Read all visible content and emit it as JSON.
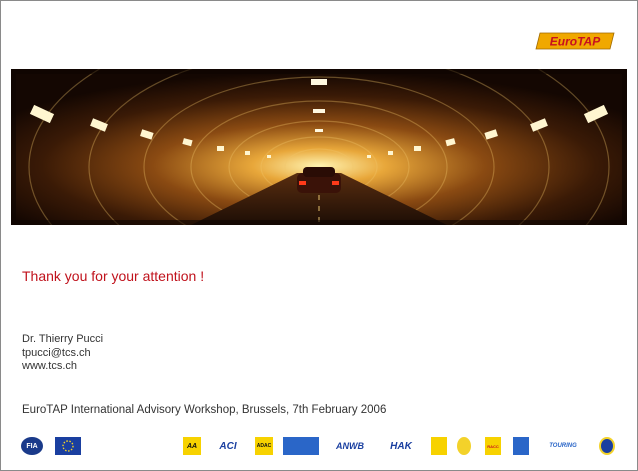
{
  "brand_logo": {
    "text": "EuroTAP",
    "color": "#f0a800",
    "text_color": "#c8101e"
  },
  "hero": {
    "icon": "road-tunnel-photo",
    "description_hidden": true
  },
  "thanks": {
    "text": "Thank you for your attention !",
    "color": "#c0121c"
  },
  "contact": {
    "name": "Dr. Thierry Pucci",
    "email": "tpucci@tcs.ch",
    "website": "www.tcs.ch"
  },
  "event": {
    "text": "EuroTAP International Advisory Workshop, Brussels, 7th February 2006"
  },
  "footer_logos": [
    {
      "icon": "fia-logo",
      "text": "FIA"
    },
    {
      "icon": "eu-flag-logo",
      "text": ""
    },
    {
      "icon": "aa-logo",
      "text": "AA"
    },
    {
      "icon": "aci-logo",
      "text": "ACI"
    },
    {
      "icon": "adac-logo",
      "text": "ADAC"
    },
    {
      "icon": "ampea-logo",
      "text": ""
    },
    {
      "icon": "anwb-logo",
      "text": "ANWB"
    },
    {
      "icon": "hak-logo",
      "text": "HAK"
    },
    {
      "icon": "oeamtc-logo",
      "text": ""
    },
    {
      "icon": "rac-logo",
      "text": ""
    },
    {
      "icon": "racc-logo",
      "text": "RACC"
    },
    {
      "icon": "raci-logo",
      "text": ""
    },
    {
      "icon": "touring-logo",
      "text": "TOURING"
    },
    {
      "icon": "tcs-logo",
      "text": ""
    }
  ]
}
